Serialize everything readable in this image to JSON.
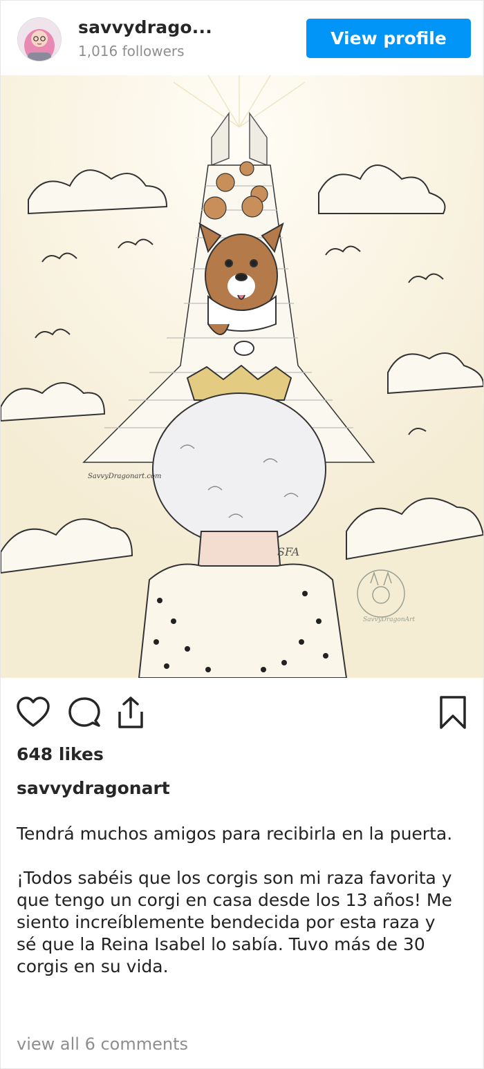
{
  "header": {
    "username": "savvydrago...",
    "followers": "1,016 followers",
    "view_profile_label": "View profile"
  },
  "post": {
    "image_alt": "Illustration of the Queen with a crown walking up a staircase to heaven, greeted by corgis among clouds",
    "artwork_signature": "SavvyDragonart.com",
    "artwork_initials": "SFA",
    "artwork_stamp": "SavvyDragonArt"
  },
  "actions": {
    "like_icon": "heart-icon",
    "comment_icon": "comment-icon",
    "share_icon": "share-icon",
    "save_icon": "bookmark-icon"
  },
  "likes": "648 likes",
  "author": "savvydragonart",
  "caption": {
    "paragraph1": "Tendrá muchos amigos para recibirla en la puerta.",
    "paragraph2": "¡Todos sabéis que los corgis son mi raza favorita y que tengo un corgi en casa desde los 13 años! Me siento increíblemente bendecida por esta raza y sé que la Reina Isabel lo sabía. Tuvo más de 30 corgis en su vida."
  },
  "view_comments": "view all 6 comments",
  "colors": {
    "accent": "#0095f6",
    "muted_text": "#8e8e8e",
    "image_background": "#f8f1dd"
  }
}
